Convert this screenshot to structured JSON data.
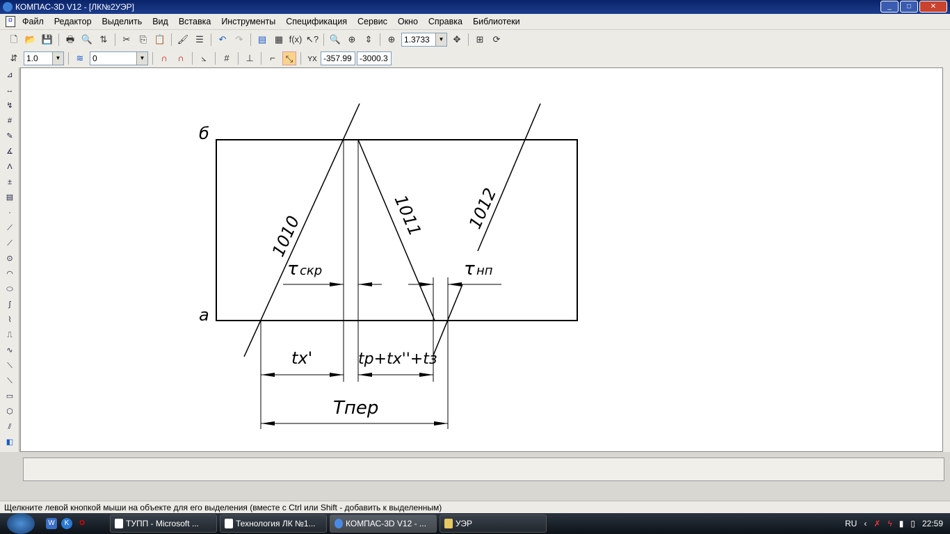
{
  "window": {
    "title": "КОМПАС-3D V12 - [ЛК№2УЭР]",
    "logo": "K",
    "controls": [
      "_",
      "□",
      "✕"
    ]
  },
  "menu": [
    "Файл",
    "Редактор",
    "Выделить",
    "Вид",
    "Вставка",
    "Инструменты",
    "Спецификация",
    "Сервис",
    "Окно",
    "Справка",
    "Библиотеки"
  ],
  "toolbar1": {
    "zoom_value": "1.3733",
    "fx_label": "f(x)"
  },
  "toolbar2": {
    "line_scale": "1.0",
    "layer": "0",
    "coord_x": "-357.99",
    "coord_y": "-3000.3"
  },
  "drawing": {
    "label_b": "б",
    "label_a": "а",
    "line_1010": "1010",
    "line_1011": "1011",
    "line_1012": "1012",
    "tau_skr": "τ",
    "tau_skr_sub": "скр",
    "tau_np": "τ",
    "tau_np_sub": "нп",
    "tx_prime": "tх'",
    "tr_formula": "tр+tх''+tз",
    "t_per": "Tпер"
  },
  "status": {
    "hint": "Щелкните левой кнопкой мыши на объекте для его выделения (вместе с Ctrl или Shift - добавить к выделенным)"
  },
  "taskbar": {
    "tasks": [
      {
        "label": "ТУПП - Microsoft ..."
      },
      {
        "label": "Технология ЛК №1..."
      },
      {
        "label": "КОМПАС-3D V12 - ..."
      },
      {
        "label": "УЭР"
      }
    ],
    "lang": "RU",
    "clock": "22:59"
  }
}
